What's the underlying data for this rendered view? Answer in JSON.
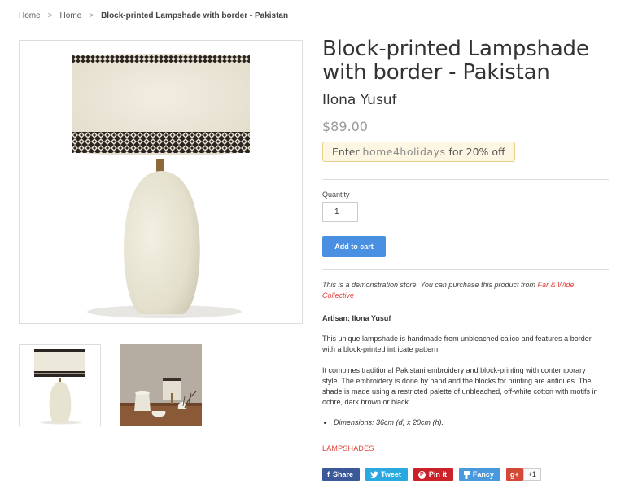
{
  "breadcrumb": {
    "home1": "Home",
    "home2": "Home",
    "separator": ">",
    "current": "Block-printed Lampshade with border - Pakistan"
  },
  "product": {
    "title_line1": "Block-printed Lampshade",
    "title_line2": "with border - Pakistan",
    "vendor": "Ilona Yusuf",
    "price": "$89.00"
  },
  "promo": {
    "prefix": "Enter",
    "code": "home4holidays",
    "suffix": "for 20% off"
  },
  "quantity": {
    "label": "Quantity",
    "value": "1"
  },
  "add_to_cart_label": "Add to cart",
  "description": {
    "demo_text": "This is a demonstration store. You can purchase this product from",
    "demo_link": "Far & Wide Collective",
    "artisan": "Artisan: Ilona Yusuf",
    "paragraph1": "This unique lampshade is handmade from unbleached calico and features a border with a block-printed intricate pattern.",
    "paragraph2": "It combines traditional Pakistani embroidery and block-printing with contemporary style. The embroidery is done by hand and the blocks for printing are antiques. The shade is made using a restricted palette of unbleached, off-white cotton with motifs in ochre, dark brown or black.",
    "bullet": "Dimensions: 36cm (d) x 20cm (h)."
  },
  "tag": "LAMPSHADES",
  "social": {
    "facebook": "Share",
    "twitter": "Tweet",
    "pinterest": "Pin it",
    "fancy": "Fancy",
    "gplus": "g+",
    "gplus_count": "+1"
  },
  "colors": {
    "accent_blue": "#4a90e2",
    "link_red": "#e0413c",
    "price_gray": "#999999",
    "promo_bg": "#fcf6e3"
  }
}
